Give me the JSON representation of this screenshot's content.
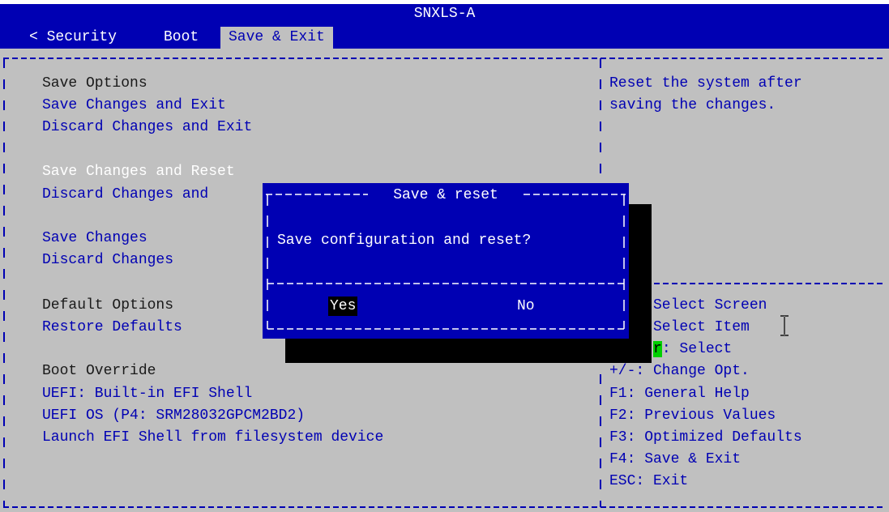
{
  "window": {
    "title": "SNXLS-A"
  },
  "tabs": [
    {
      "label": "< Security"
    },
    {
      "label": "Boot"
    },
    {
      "label": "Save & Exit",
      "active": true
    }
  ],
  "menu": {
    "save_options_header": "Save Options",
    "save_changes_and_exit": "Save Changes and Exit",
    "discard_changes_and_exit": "Discard Changes and Exit",
    "save_changes_and_reset": "Save Changes and Reset",
    "discard_changes_and_reset": "Discard Changes and",
    "save_changes": "Save Changes",
    "discard_changes": "Discard Changes",
    "default_options_header": "Default Options",
    "restore_defaults": "Restore Defaults",
    "boot_override_header": "Boot Override",
    "uefi_builtin_shell": "UEFI: Built-in EFI Shell",
    "uefi_os": "UEFI OS (P4: SRM28032GPCM2BD2)",
    "launch_efi_shell": "Launch EFI Shell from filesystem device"
  },
  "help_text": {
    "line1": "Reset the system after",
    "line2": "saving the changes."
  },
  "keys": {
    "select_screen": "Select Screen",
    "select_item": "Select Item",
    "enter_key": "r",
    "enter_select": ": Select",
    "change_opt": "+/-: Change Opt.",
    "general_help": "F1: General Help",
    "previous_values": "F2: Previous Values",
    "optimized_defaults": "F3: Optimized Defaults",
    "save_exit": "F4: Save & Exit",
    "esc_exit": "ESC: Exit"
  },
  "dialog": {
    "title": "Save & reset",
    "message": "Save configuration and reset?",
    "yes_label": "Yes",
    "no_label": "No"
  },
  "colors": {
    "bios_blue": "#0000b3",
    "bios_gray": "#c0c0c0",
    "highlight_green": "#00d000"
  }
}
